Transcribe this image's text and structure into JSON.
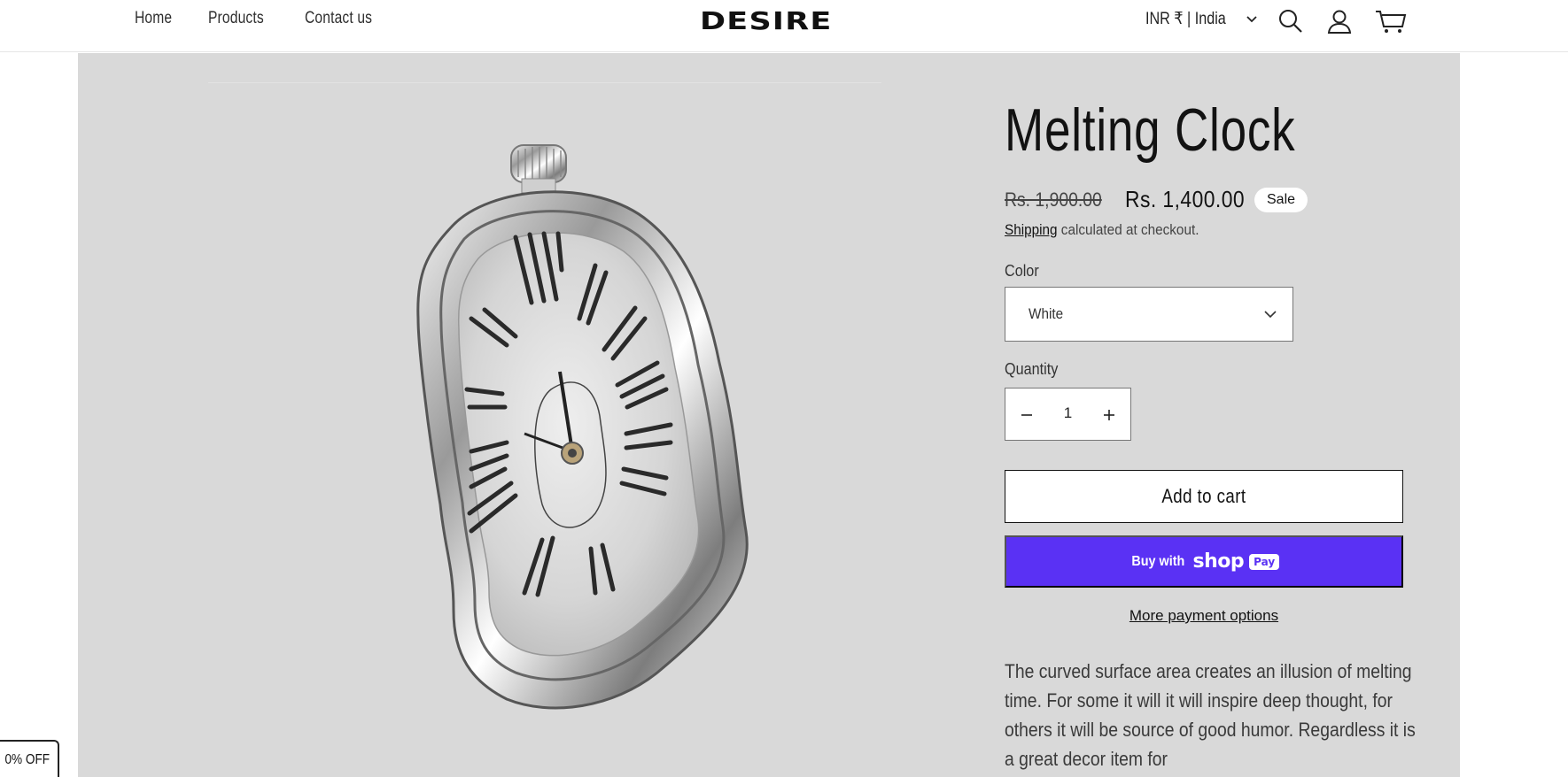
{
  "header": {
    "nav": [
      "Home",
      "Products",
      "Contact us"
    ],
    "logo": "DESIRE",
    "locale": "INR ₹ | India",
    "icons": [
      "search-icon",
      "account-icon",
      "cart-icon"
    ]
  },
  "product": {
    "title": "Melting Clock",
    "old_price": "Rs. 1,900.00",
    "price": "Rs. 1,400.00",
    "badge": "Sale",
    "shipping_link": "Shipping",
    "shipping_rest": " calculated at checkout.",
    "color_label": "Color",
    "color_value": "White",
    "quantity_label": "Quantity",
    "quantity": "1",
    "add_to_cart": "Add to cart",
    "buy_with": "Buy with",
    "shop_word": "shop",
    "pay_word": "Pay",
    "more_payment": "More payment options",
    "description": "The curved surface area creates an illusion of melting time. For some it will it will inspire deep thought, for others it will be source of good humor. Regardless it is a great decor item for"
  },
  "discount_tab": "0% OFF",
  "colors": {
    "panel": "#d9d9d9",
    "shop_pay": "#5a31f4"
  }
}
